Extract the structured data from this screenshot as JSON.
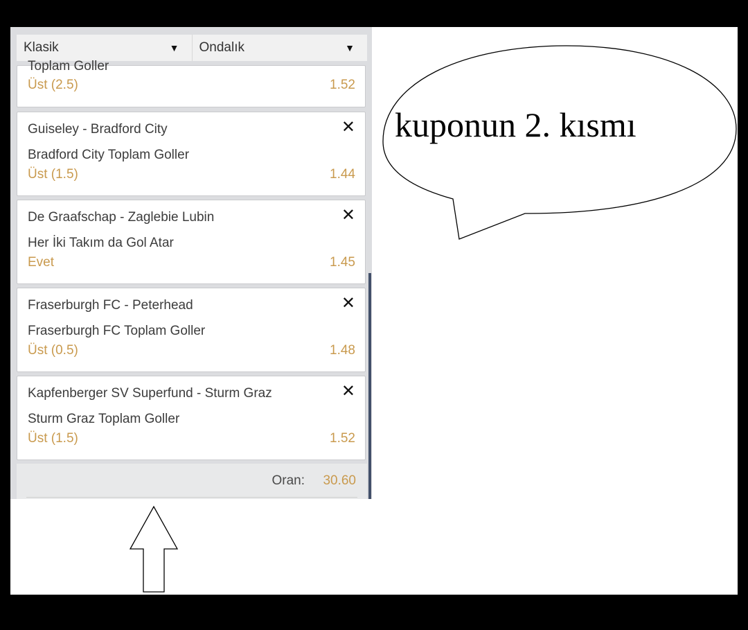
{
  "toolbar": {
    "type_select": "Klasik",
    "odds_format_select": "Ondalık",
    "caret": "▼"
  },
  "partial_card": {
    "market": "Toplam Goller",
    "selection": "Üst (2.5)",
    "odds": "1.52"
  },
  "cards": [
    {
      "match": "Guiseley - Bradford City",
      "market": "Bradford City Toplam Goller",
      "selection": "Üst (1.5)",
      "odds": "1.44",
      "close": "✕"
    },
    {
      "match": "De Graafschap - Zaglebie Lubin",
      "market": "Her İki Takım da Gol Atar",
      "selection": "Evet",
      "odds": "1.45",
      "close": "✕"
    },
    {
      "match": "Fraserburgh FC - Peterhead",
      "market": "Fraserburgh FC Toplam Goller",
      "selection": "Üst (0.5)",
      "odds": "1.48",
      "close": "✕"
    },
    {
      "match": "Kapfenberger SV Superfund - Sturm Graz",
      "market": "Sturm Graz Toplam Goller",
      "selection": "Üst (1.5)",
      "odds": "1.52",
      "close": "✕"
    }
  ],
  "footer": {
    "total_label": "Oran:",
    "total_value": "30.60"
  },
  "annotation": {
    "bubble_text": "kuponun 2. kısmı"
  },
  "colors": {
    "odds_accent": "#c99a4e",
    "panel_bg": "#dcdde0",
    "scrollbar": "#43506a"
  },
  "icons": {
    "dropdown": "chevron-down-icon",
    "remove": "close-icon",
    "pointer": "up-arrow-icon"
  }
}
